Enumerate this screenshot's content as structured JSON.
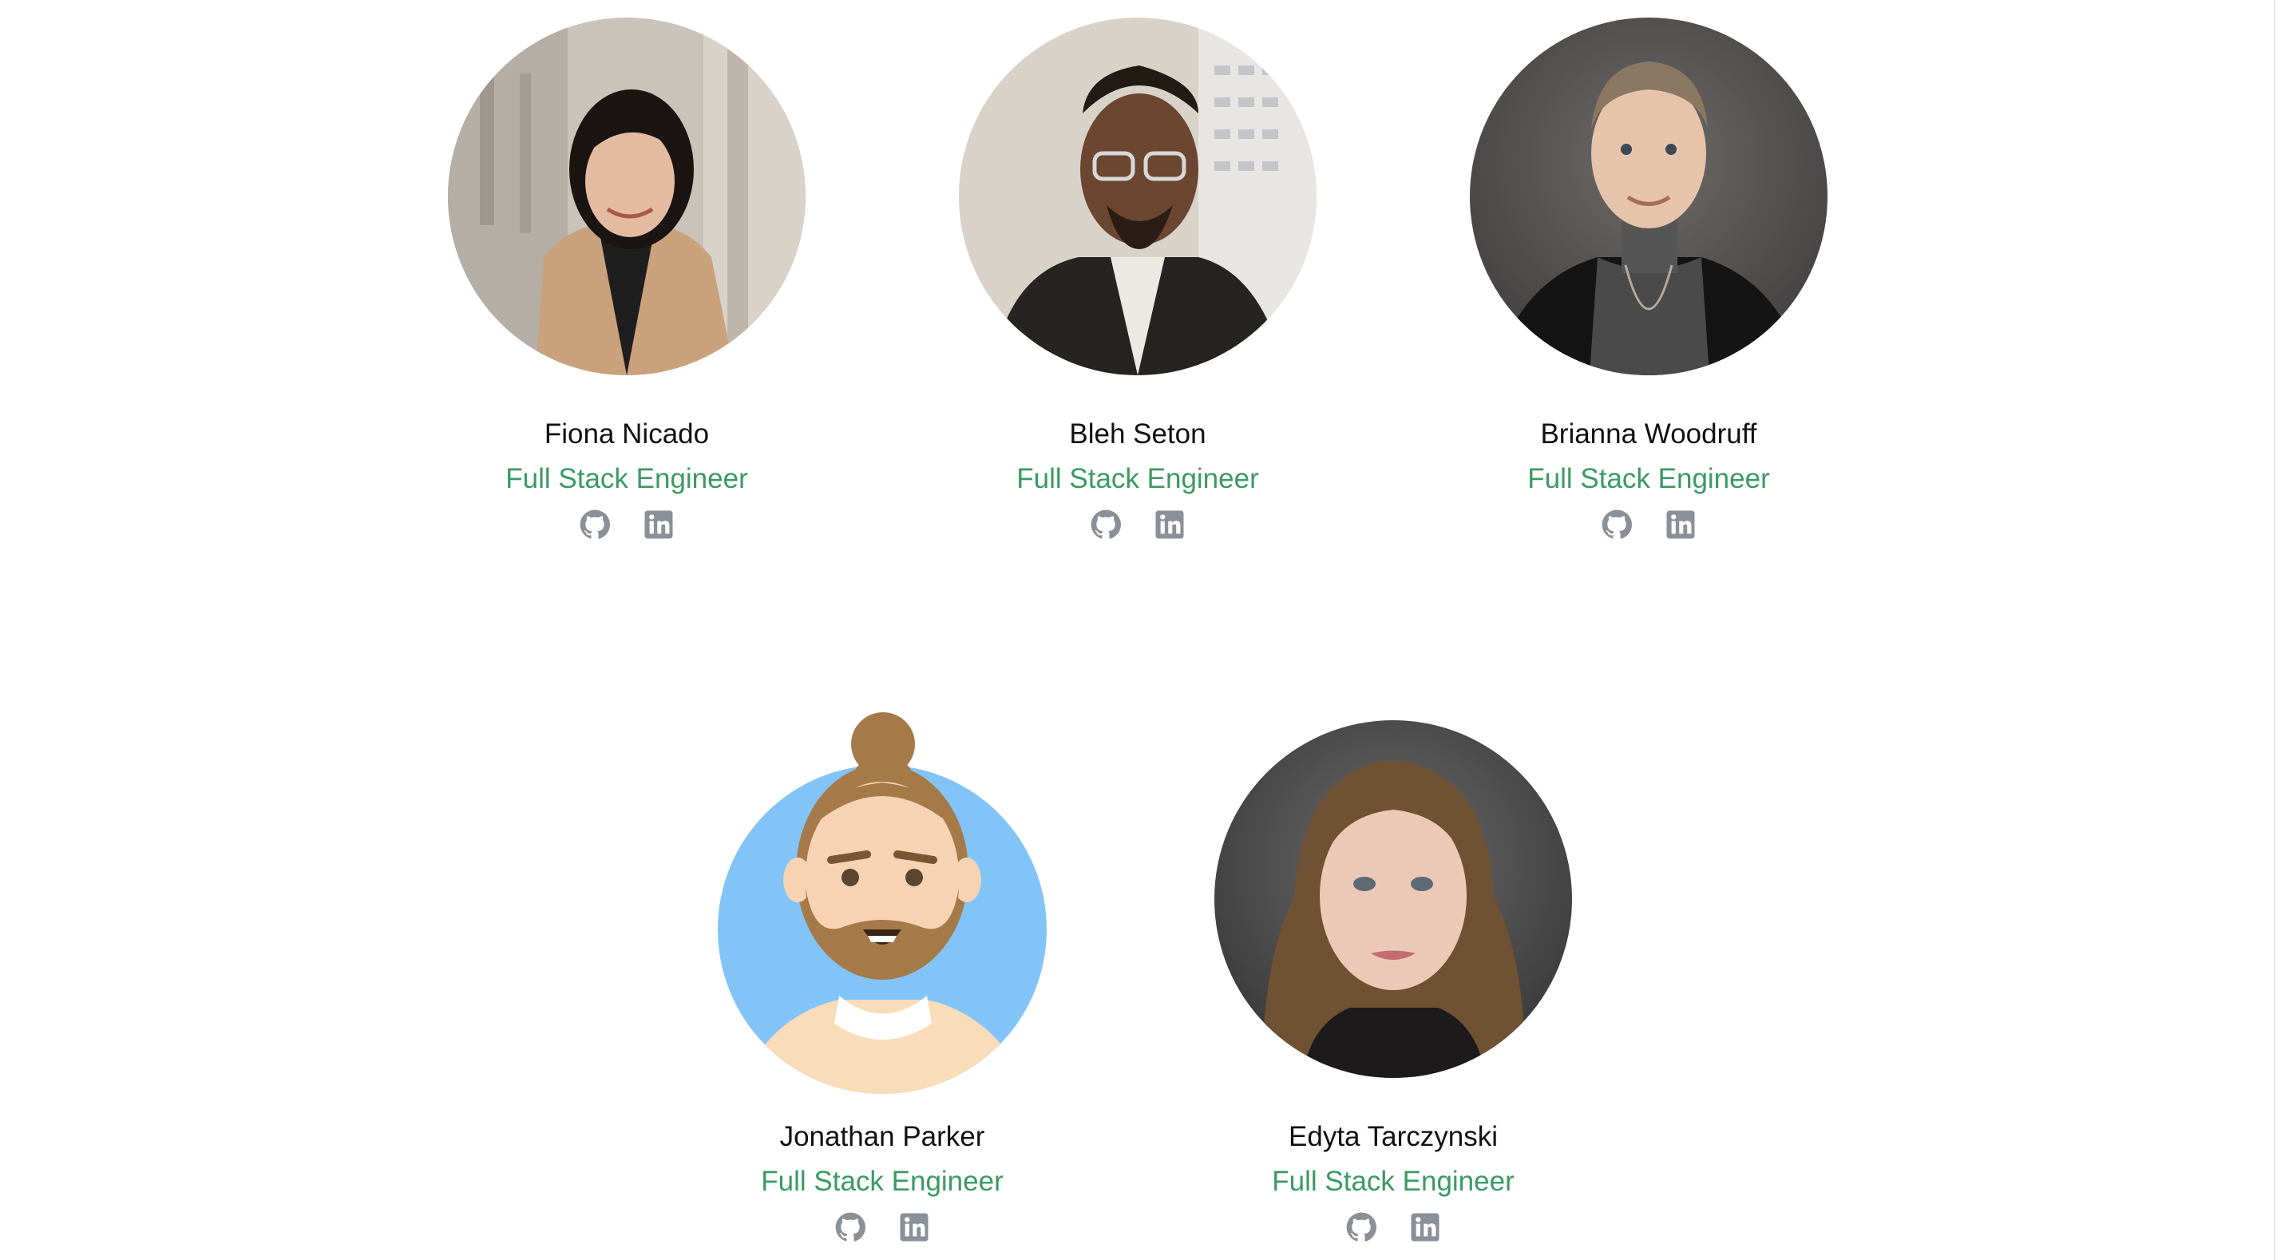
{
  "team": {
    "members": [
      {
        "name": "Fiona Nicado",
        "role": "Full Stack Engineer",
        "github_icon": "github-icon",
        "linkedin_icon": "linkedin-icon"
      },
      {
        "name": "Bleh Seton",
        "role": "Full Stack Engineer",
        "github_icon": "github-icon",
        "linkedin_icon": "linkedin-icon"
      },
      {
        "name": "Brianna Woodruff",
        "role": "Full Stack Engineer",
        "github_icon": "github-icon",
        "linkedin_icon": "linkedin-icon"
      },
      {
        "name": "Jonathan Parker",
        "role": "Full Stack Engineer",
        "github_icon": "github-icon",
        "linkedin_icon": "linkedin-icon"
      },
      {
        "name": "Edyta Tarczynski",
        "role": "Full Stack Engineer",
        "github_icon": "github-icon",
        "linkedin_icon": "linkedin-icon"
      }
    ]
  },
  "colors": {
    "role_text": "#3b9a63",
    "name_text": "#111111",
    "icon_gray": "#8a8f98",
    "background": "#ffffff"
  }
}
